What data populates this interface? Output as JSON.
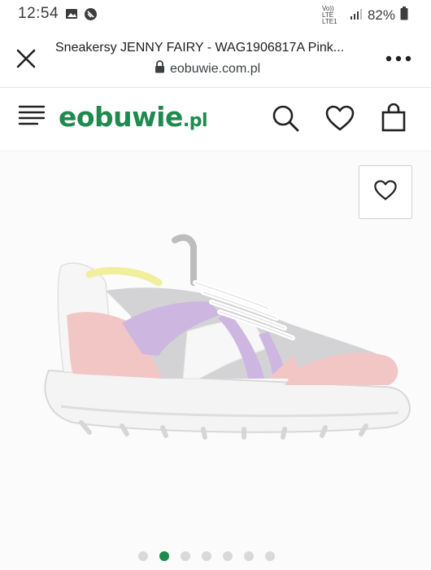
{
  "status_bar": {
    "time": "12:54",
    "network_label_top": "Vo)) LTE",
    "network_label_bottom": "LTE1",
    "battery_percent": "82%"
  },
  "browser": {
    "page_title": "Sneakersy JENNY FAIRY - WAG1906817A Pink...",
    "url": "eobuwie.com.pl"
  },
  "site": {
    "logo_main": "eobuwie",
    "logo_tld": ".pl",
    "brand_color": "#1f8a4d"
  },
  "gallery": {
    "slide_count": 7,
    "active_slide_index": 1,
    "favorite_icon": "heart-icon"
  }
}
